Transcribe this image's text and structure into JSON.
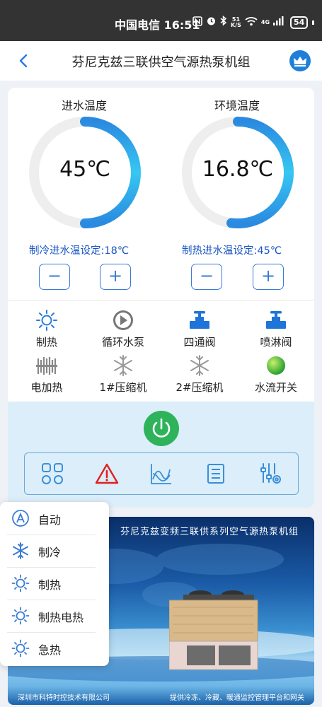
{
  "status_bar": {
    "carrier_time": "中国电信 16:51",
    "network_speed_top": "51",
    "network_speed_bottom": "K/S",
    "signal_label": "4G",
    "battery": "54"
  },
  "header": {
    "title": "芬尼克兹三联供空气源热泵机组"
  },
  "gauges": [
    {
      "label": "进水温度",
      "value": "45℃",
      "fill_fraction": 0.5
    },
    {
      "label": "环境温度",
      "value": "16.8℃",
      "fill_fraction": 0.52
    }
  ],
  "setpoints": {
    "cooling": "制冷进水温设定:18℃",
    "heating": "制热进水温设定:45℃",
    "minus": "−",
    "plus": "+"
  },
  "status_items": [
    {
      "label": "制热",
      "icon": "sun-icon"
    },
    {
      "label": "循环水泵",
      "icon": "pump-play-icon"
    },
    {
      "label": "四通阀",
      "icon": "valve-icon"
    },
    {
      "label": "喷淋阀",
      "icon": "valve-icon"
    },
    {
      "label": "电加热",
      "icon": "heater-icon"
    },
    {
      "label": "1#压缩机",
      "icon": "snowflake-icon"
    },
    {
      "label": "2#压缩机",
      "icon": "snowflake-icon"
    },
    {
      "label": "水流开关",
      "icon": "green-ball-icon"
    }
  ],
  "toolbar": [
    {
      "icon": "grid-apps-icon"
    },
    {
      "icon": "warning-icon"
    },
    {
      "icon": "curve-chart-icon"
    },
    {
      "icon": "list-doc-icon"
    },
    {
      "icon": "settings-sliders-icon"
    }
  ],
  "banner": {
    "title": "芬尼克兹变频三联供系列空气源热泵机组",
    "footer_left": "深圳市科特时控技术有限公司",
    "footer_right": "提供冷冻、冷藏、暖通监控管理平台和网关"
  },
  "mode_menu": [
    {
      "label": "自动",
      "icon": "auto-a-icon"
    },
    {
      "label": "制冷",
      "icon": "snowflake-icon"
    },
    {
      "label": "制热",
      "icon": "sun-icon"
    },
    {
      "label": "制热电热",
      "icon": "sun-icon"
    },
    {
      "label": "急热",
      "icon": "sun-icon"
    }
  ],
  "colors": {
    "accent_blue": "#3a7bd5",
    "gauge_arc": "#2fc4f0",
    "power_green": "#2eb35a",
    "warning_red": "#e02020",
    "setpoint_text": "#1a56c4"
  }
}
